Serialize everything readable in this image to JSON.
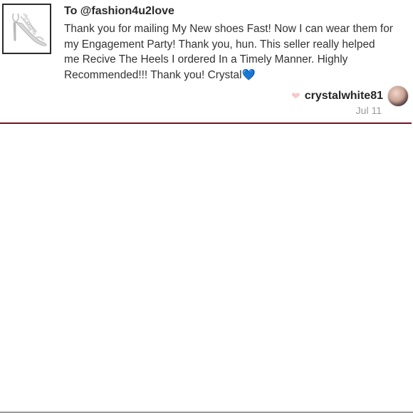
{
  "review": {
    "recipient": "To @fashion4u2love",
    "message": "Thank you for mailing My New shoes Fast! Now I can wear them for my Engagement Party! Thank you, hun. This seller really helped me Recive The Heels I ordered In a Timely Manner. Highly Recommended!!! Thank you! Crystal",
    "emoji": "💙",
    "reaction_icon": "heart-icon",
    "username": "crystalwhite81",
    "date": "Jul 11",
    "thumbnail": "silver-strappy-heel-sandal"
  },
  "colors": {
    "divider": "#6e1423",
    "heart": "#f4c9cd",
    "blue_heart": "#3d8fe0",
    "date_text": "#9a9a9a"
  }
}
